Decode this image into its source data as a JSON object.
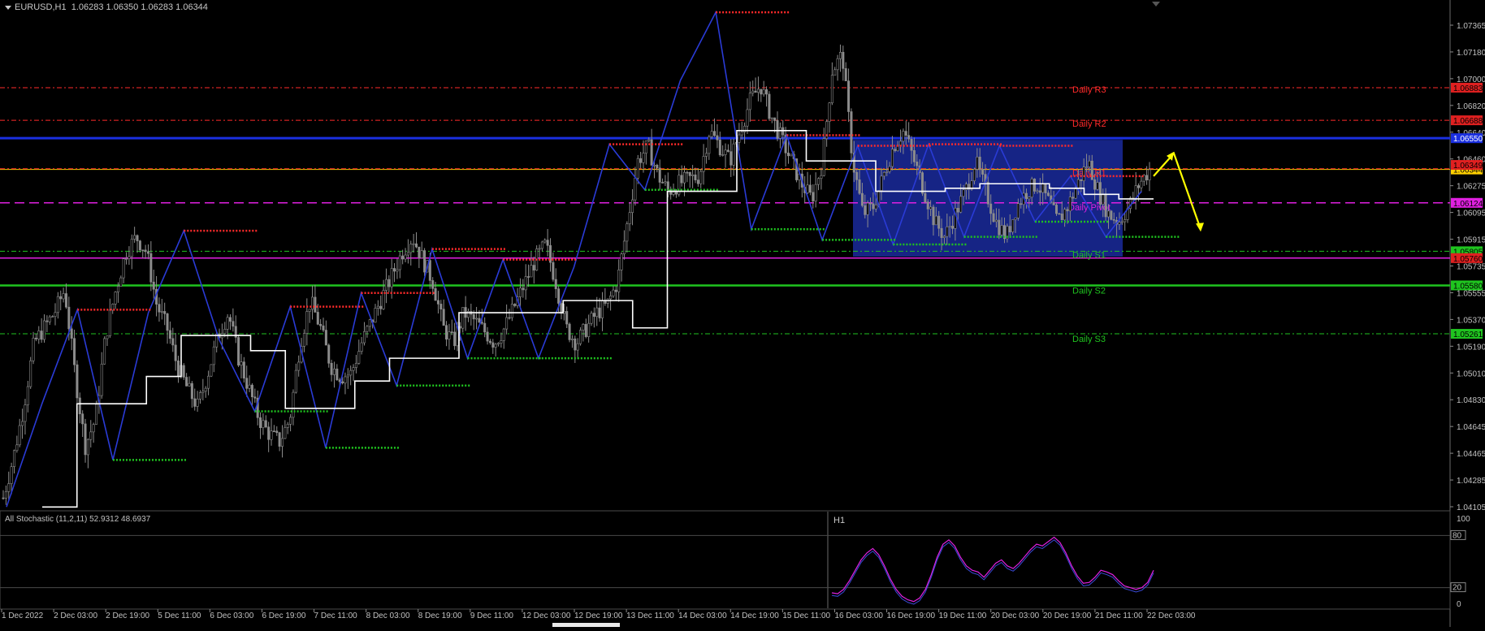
{
  "header": {
    "symbol": "EURUSD,H1",
    "ohlc": "1.06283 1.06350 1.06283 1.06344"
  },
  "colors": {
    "background": "#000000",
    "grid": "#3a3a3a",
    "candles": "#8c8c8c",
    "zigzag": "#2a3bd6",
    "staircase": "#ffffff",
    "resistance": "#ff2a2a",
    "support": "#1fc41f",
    "pivot": "#e020e0",
    "blue_level": "#1a2fe0",
    "yellow_line": "#ffd000",
    "arrow": "#ffff00",
    "box": "#1a2a9c",
    "stochastic": "#e020e0"
  },
  "price_axis": {
    "ticks": [
      "1.07365",
      "1.07180",
      "1.07000",
      "1.06820",
      "1.06640",
      "1.06460",
      "1.06275",
      "1.06095",
      "1.05915",
      "1.05735",
      "1.05555",
      "1.05370",
      "1.05190",
      "1.05010",
      "1.04830",
      "1.04645",
      "1.04465",
      "1.04285",
      "1.04105"
    ],
    "price_labels": [
      {
        "text": "1.06883",
        "color": "#e02020",
        "fg": "#000000"
      },
      {
        "text": "1.06688",
        "color": "#e02020",
        "fg": "#000000"
      },
      {
        "text": "1.06550",
        "color": "#1a2fe0",
        "fg": "#ffffff"
      },
      {
        "text": "1.06344",
        "color": "#ffd000",
        "fg": "#000000"
      },
      {
        "text": "1.06349",
        "color": "#e02020",
        "fg": "#000000"
      },
      {
        "text": "1.06124",
        "color": "#e020e0",
        "fg": "#000000"
      },
      {
        "text": "1.05805",
        "color": "#1fc41f",
        "fg": "#000000"
      },
      {
        "text": "1.05760",
        "color": "#e02020",
        "fg": "#000000"
      },
      {
        "text": "1.05580",
        "color": "#1fc41f",
        "fg": "#000000"
      },
      {
        "text": "1.05261",
        "color": "#1fc41f",
        "fg": "#000000"
      }
    ]
  },
  "pivot_labels": {
    "r3": "Daily R3",
    "r2": "Daily R2",
    "r1": "Daily R1",
    "pivot": "Daily Pivot",
    "s1": "Daily S1",
    "s2": "Daily S2",
    "s3": "Daily S3"
  },
  "time_axis": {
    "labels": [
      "1 Dec 2022",
      "2 Dec 03:00",
      "2 Dec 19:00",
      "5 Dec 11:00",
      "6 Dec 03:00",
      "6 Dec 19:00",
      "7 Dec 11:00",
      "8 Dec 03:00",
      "8 Dec 19:00",
      "9 Dec 11:00",
      "12 Dec 03:00",
      "12 Dec 19:00",
      "13 Dec 11:00",
      "14 Dec 03:00",
      "14 Dec 19:00",
      "15 Dec 11:00",
      "16 Dec 03:00",
      "16 Dec 19:00",
      "19 Dec 11:00",
      "20 Dec 03:00",
      "20 Dec 19:00",
      "21 Dec 11:00",
      "22 Dec 03:00"
    ]
  },
  "stochastic": {
    "label": "All Stochastic (11,2,11) 52.9312 48.6937",
    "timeframe": "H1",
    "axis": {
      "top": "100",
      "upper": "80",
      "lower": "20",
      "bottom": "0"
    },
    "values": [
      14,
      13,
      18,
      28,
      40,
      52,
      60,
      65,
      58,
      45,
      30,
      18,
      10,
      6,
      4,
      8,
      18,
      35,
      55,
      70,
      75,
      68,
      55,
      45,
      40,
      38,
      32,
      40,
      48,
      52,
      45,
      42,
      48,
      56,
      64,
      70,
      68,
      73,
      78,
      72,
      60,
      45,
      33,
      25,
      26,
      32,
      40,
      38,
      35,
      28,
      22,
      20,
      18,
      20,
      26,
      40
    ]
  },
  "chart_data": {
    "type": "candlestick",
    "title": "EURUSD,H1",
    "ylim": [
      1.041,
      1.0745
    ],
    "ohlc_last": {
      "open": 1.06283,
      "high": 1.0635,
      "low": 1.06283,
      "close": 1.06344
    },
    "levels": {
      "daily_r3": 1.06883,
      "daily_r2": 1.06668,
      "daily_r1": 1.06349,
      "daily_pivot": 1.06124,
      "daily_s1": 1.05805,
      "daily_s2": 1.0558,
      "daily_s3": 1.05261,
      "blue_level": 1.0655,
      "yellow_line": 1.06344,
      "magenta_level": 1.0576
    },
    "zigzag": [
      1.0412,
      1.048,
      1.0542,
      1.0443,
      1.054,
      1.0594,
      1.0522,
      1.0475,
      1.0544,
      1.0451,
      1.0553,
      1.0492,
      1.0582,
      1.051,
      1.0575,
      1.051,
      1.057,
      1.0651,
      1.0621,
      1.0693,
      1.0738,
      1.0595,
      1.0657,
      1.0588,
      1.065,
      1.0585,
      1.0651,
      1.059,
      1.065,
      1.06,
      1.063,
      1.059,
      1.062
    ],
    "forecast_arrow": [
      1.063,
      1.0645,
      1.0595
    ],
    "price_path": [
      1.0418,
      1.0445,
      1.0478,
      1.052,
      1.053,
      1.054,
      1.0555,
      1.05,
      1.0452,
      1.047,
      1.0525,
      1.0555,
      1.058,
      1.059,
      1.058,
      1.0545,
      1.053,
      1.0505,
      1.049,
      1.0478,
      1.05,
      1.0525,
      1.054,
      1.051,
      1.049,
      1.047,
      1.046,
      1.0455,
      1.047,
      1.052,
      1.0548,
      1.053,
      1.0505,
      1.0498,
      1.05,
      1.052,
      1.0535,
      1.055,
      1.0565,
      1.058,
      1.059,
      1.0575,
      1.056,
      1.053,
      1.052,
      1.054,
      1.0535,
      1.0528,
      1.052,
      1.053,
      1.0545,
      1.056,
      1.0575,
      1.0585,
      1.056,
      1.053,
      1.052,
      1.053,
      1.054,
      1.0545,
      1.056,
      1.06,
      1.064,
      1.065,
      1.063,
      1.062,
      1.0625,
      1.0628,
      1.063,
      1.066,
      1.065,
      1.064,
      1.066,
      1.068,
      1.069,
      1.067,
      1.0655,
      1.064,
      1.0625,
      1.0615,
      1.0638,
      1.07,
      1.071,
      1.064,
      1.0605,
      1.061,
      1.063,
      1.065,
      1.066,
      1.064,
      1.062,
      1.06,
      1.059,
      1.0605,
      1.062,
      1.064,
      1.062,
      1.06,
      1.059,
      1.061,
      1.062,
      1.0625,
      1.0615,
      1.06,
      1.061,
      1.0625,
      1.064,
      1.062,
      1.0605,
      1.06,
      1.061,
      1.0625,
      1.0634
    ]
  }
}
